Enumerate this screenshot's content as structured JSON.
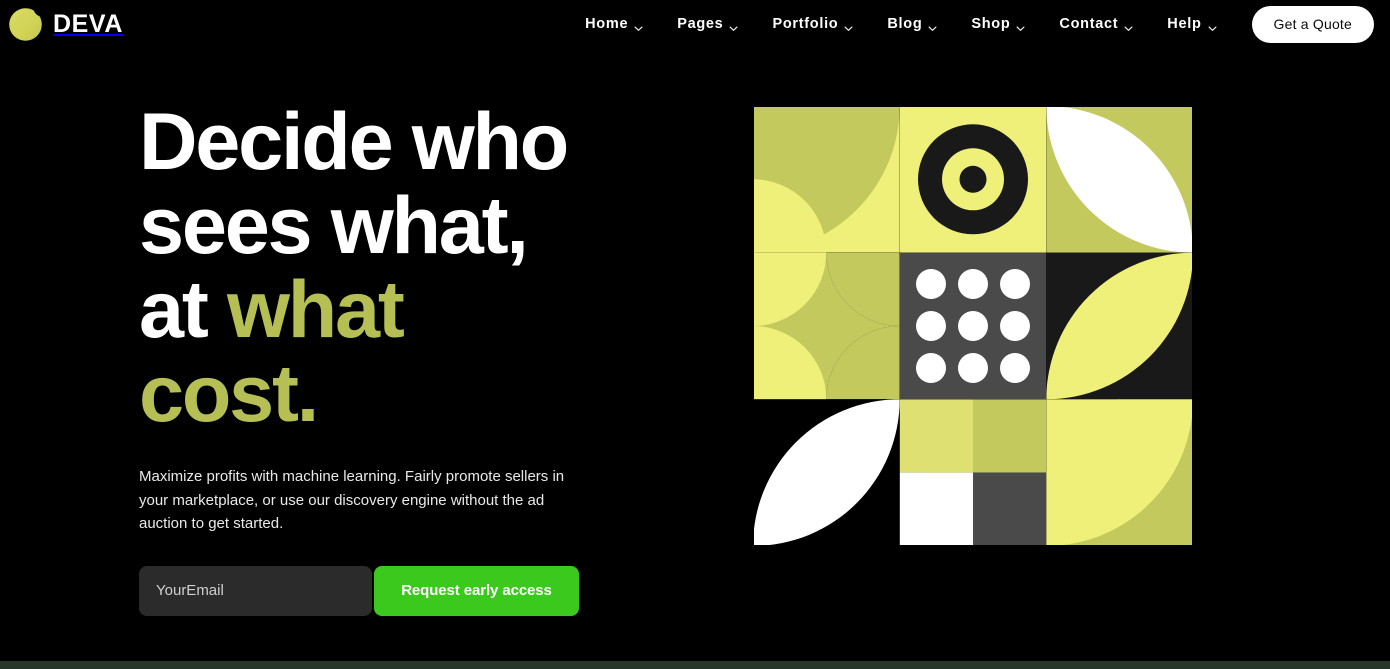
{
  "header": {
    "brand_name": "DEVA",
    "brand_logo_icon": "deva-circle-logo",
    "nav_items": [
      {
        "label": "Home",
        "has_dropdown": true,
        "icon": "chevron-down-icon"
      },
      {
        "label": "Pages",
        "has_dropdown": true,
        "icon": "chevron-down-icon"
      },
      {
        "label": "Portfolio",
        "has_dropdown": true,
        "icon": "chevron-down-icon"
      },
      {
        "label": "Blog",
        "has_dropdown": true,
        "icon": "chevron-down-icon"
      },
      {
        "label": "Shop",
        "has_dropdown": true,
        "icon": "chevron-down-icon"
      },
      {
        "label": "Contact",
        "has_dropdown": true,
        "icon": "chevron-down-icon"
      },
      {
        "label": "Help",
        "has_dropdown": true,
        "icon": "chevron-down-icon"
      }
    ],
    "cta_label": "Get a Quote"
  },
  "hero": {
    "title_line_1": "Decide who",
    "title_line_2": "sees what,",
    "title_line_3_plain": "at ",
    "title_line_3_accent": "what",
    "title_line_4_accent": "cost.",
    "subtitle": "Maximize profits with machine learning. Fairly promote sellers in your marketplace, or use our discovery engine without the ad auction to get started.",
    "email_placeholder": "YourEmail",
    "email_value": "",
    "submit_label": "Request early access",
    "art_alt": "abstract-geometric-pattern"
  },
  "colors": {
    "page_background": "#000000",
    "accent_olive": "#b5bf54",
    "accent_green_button": "#3cc91e",
    "logo_yellow": "#d2d457",
    "art_light_yellow": "#eff07a",
    "art_olive": "#c3c95c",
    "art_black": "#191919",
    "art_gray": "#4a4a4a",
    "art_white": "#ffffff",
    "input_background": "#2b2b2b",
    "bottom_strip": "#26362a"
  }
}
